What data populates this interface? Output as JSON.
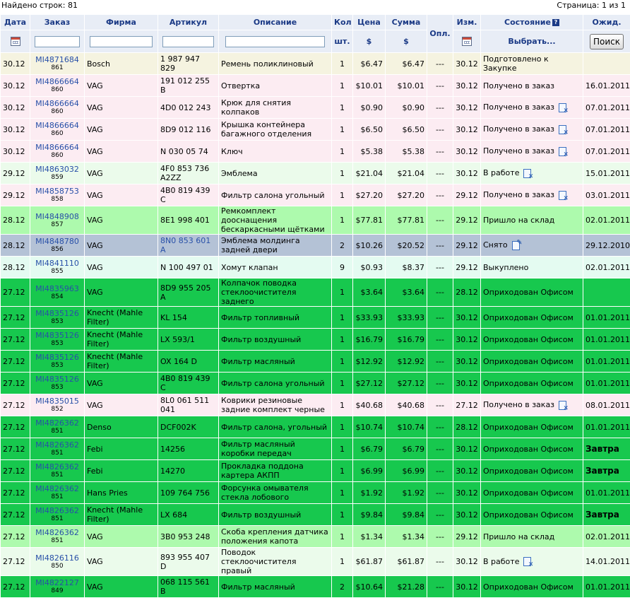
{
  "topbar": {
    "found_label": "Найдено строк: 81",
    "page_label": "Страница: 1 из 1"
  },
  "header": {
    "date": "Дата",
    "order": "Заказ",
    "firm": "Фирма",
    "article": "Артикул",
    "description": "Описание",
    "qty": "Кол",
    "qty_unit": "шт.",
    "price": "Цена",
    "price_unit": "$",
    "sum": "Сумма",
    "sum_unit": "$",
    "paid": "Опл.",
    "changed": "Изм.",
    "state": "Состояние",
    "state_select": "Выбрать...",
    "expected": "Ожид.",
    "search_button": "Поиск"
  },
  "colors": {
    "cream": "#f5f3e0",
    "pink": "#fcecf2",
    "lightgreen": "#ebfbeb",
    "green": "#adfaad",
    "blue": "#b4c2d6",
    "mint": "#e4fbf1",
    "bright": "#17c84e"
  },
  "rows": [
    {
      "date": "30.12",
      "order": "MI4871684",
      "sub": "861",
      "firm": "Bosch",
      "article": "1 987 947 829",
      "desc": "Ремень поликлиновый",
      "qty": "1",
      "price": "$6.47",
      "sum": "$6.47",
      "paid": "---",
      "changed": "30.12",
      "state": "Подготовлено к Закупке",
      "icon": "",
      "expected": "",
      "bg": "cream",
      "bold": false,
      "sku_link": false
    },
    {
      "date": "30.12",
      "order": "MI4866664",
      "sub": "860",
      "firm": "VAG",
      "article": "191 012 255 B",
      "desc": "Отвертка",
      "qty": "1",
      "price": "$10.01",
      "sum": "$10.01",
      "paid": "---",
      "changed": "30.12",
      "state": "Получено в заказ",
      "icon": "",
      "expected": "16.01.2011",
      "bg": "pink",
      "bold": false,
      "sku_link": false
    },
    {
      "date": "30.12",
      "order": "MI4866664",
      "sub": "860",
      "firm": "VAG",
      "article": "4D0 012 243",
      "desc": "Крюк для снятия колпаков",
      "qty": "1",
      "price": "$0.90",
      "sum": "$0.90",
      "paid": "---",
      "changed": "30.12",
      "state": "Получено в заказ",
      "icon": "delete",
      "expected": "07.01.2011",
      "bg": "pink",
      "bold": false,
      "sku_link": false
    },
    {
      "date": "30.12",
      "order": "MI4866664",
      "sub": "860",
      "firm": "VAG",
      "article": "8D9 012 116",
      "desc": "Крышка контейнера багажного отделения",
      "qty": "1",
      "price": "$6.50",
      "sum": "$6.50",
      "paid": "---",
      "changed": "30.12",
      "state": "Получено в заказ",
      "icon": "delete",
      "expected": "07.01.2011",
      "bg": "pink",
      "bold": false,
      "sku_link": false
    },
    {
      "date": "30.12",
      "order": "MI4866664",
      "sub": "860",
      "firm": "VAG",
      "article": "N 030 05 74",
      "desc": "Ключ",
      "qty": "1",
      "price": "$5.38",
      "sum": "$5.38",
      "paid": "---",
      "changed": "30.12",
      "state": "Получено в заказ",
      "icon": "delete",
      "expected": "07.01.2011",
      "bg": "pink",
      "bold": false,
      "sku_link": false
    },
    {
      "date": "29.12",
      "order": "MI4863032",
      "sub": "859",
      "firm": "VAG",
      "article": "4F0 853 736 A2ZZ",
      "desc": "Эмблема",
      "qty": "1",
      "price": "$21.04",
      "sum": "$21.04",
      "paid": "---",
      "changed": "30.12",
      "state": "В работе",
      "icon": "delete",
      "expected": "15.01.2011",
      "bg": "lightgreen",
      "bold": false,
      "sku_link": false
    },
    {
      "date": "29.12",
      "order": "MI4858753",
      "sub": "858",
      "firm": "VAG",
      "article": "4B0 819 439 C",
      "desc": "Фильтр салона угольный",
      "qty": "1",
      "price": "$27.20",
      "sum": "$27.20",
      "paid": "---",
      "changed": "29.12",
      "state": "Получено в заказ",
      "icon": "delete",
      "expected": "03.01.2011",
      "bg": "pink",
      "bold": false,
      "sku_link": false
    },
    {
      "date": "28.12",
      "order": "MI4848908",
      "sub": "857",
      "firm": "VAG",
      "article": "8E1 998 401",
      "desc": "Ремкомплект дооснащения бескаркасными щётками",
      "qty": "1",
      "price": "$77.81",
      "sum": "$77.81",
      "paid": "---",
      "changed": "29.12",
      "state": "Пришло на склад",
      "icon": "",
      "expected": "02.01.2011",
      "bg": "green",
      "bold": false,
      "sku_link": false
    },
    {
      "date": "28.12",
      "order": "MI4848780",
      "sub": "856",
      "firm": "VAG",
      "article": "8N0 853 601 A",
      "desc": "Эмблема молдинга задней двери",
      "qty": "2",
      "price": "$10.26",
      "sum": "$20.52",
      "paid": "---",
      "changed": "29.12",
      "state": "Снято",
      "icon": "edit",
      "expected": "29.12.2010",
      "bg": "blue",
      "bold": false,
      "sku_link": true
    },
    {
      "date": "28.12",
      "order": "MI4841110",
      "sub": "855",
      "firm": "VAG",
      "article": "N 100 497 01",
      "desc": "Хомут клапан",
      "qty": "9",
      "price": "$0.93",
      "sum": "$8.37",
      "paid": "---",
      "changed": "29.12",
      "state": "Выкуплено",
      "icon": "",
      "expected": "02.01.2011",
      "bg": "mint",
      "bold": false,
      "sku_link": false
    },
    {
      "date": "27.12",
      "order": "MI4835963",
      "sub": "854",
      "firm": "VAG",
      "article": "8D9 955 205 A",
      "desc": "Колпачок поводка стеклоочистителя заднего",
      "qty": "1",
      "price": "$3.64",
      "sum": "$3.64",
      "paid": "---",
      "changed": "28.12",
      "state": "Оприходован Офисом",
      "icon": "",
      "expected": "",
      "bg": "bright",
      "bold": false,
      "sku_link": false
    },
    {
      "date": "27.12",
      "order": "MI4835126",
      "sub": "853",
      "firm": "Knecht (Mahle Filter)",
      "article": "KL 154",
      "desc": "Фильтр топливный",
      "qty": "1",
      "price": "$33.93",
      "sum": "$33.93",
      "paid": "---",
      "changed": "30.12",
      "state": "Оприходован Офисом",
      "icon": "",
      "expected": "01.01.2011",
      "bg": "bright",
      "bold": false,
      "sku_link": false
    },
    {
      "date": "27.12",
      "order": "MI4835126",
      "sub": "853",
      "firm": "Knecht (Mahle Filter)",
      "article": "LX 593/1",
      "desc": "Фильтр воздушный",
      "qty": "1",
      "price": "$16.79",
      "sum": "$16.79",
      "paid": "---",
      "changed": "30.12",
      "state": "Оприходован Офисом",
      "icon": "",
      "expected": "01.01.2011",
      "bg": "bright",
      "bold": false,
      "sku_link": false
    },
    {
      "date": "27.12",
      "order": "MI4835126",
      "sub": "853",
      "firm": "Knecht (Mahle Filter)",
      "article": "OX 164 D",
      "desc": "Фильтр масляный",
      "qty": "1",
      "price": "$12.92",
      "sum": "$12.92",
      "paid": "---",
      "changed": "30.12",
      "state": "Оприходован Офисом",
      "icon": "",
      "expected": "01.01.2011",
      "bg": "bright",
      "bold": false,
      "sku_link": false
    },
    {
      "date": "27.12",
      "order": "MI4835126",
      "sub": "853",
      "firm": "VAG",
      "article": "4B0 819 439 C",
      "desc": "Фильтр салона угольный",
      "qty": "1",
      "price": "$27.12",
      "sum": "$27.12",
      "paid": "---",
      "changed": "30.12",
      "state": "Оприходован Офисом",
      "icon": "",
      "expected": "01.01.2011",
      "bg": "bright",
      "bold": false,
      "sku_link": false
    },
    {
      "date": "27.12",
      "order": "MI4835015",
      "sub": "852",
      "firm": "VAG",
      "article": "8L0 061 511 041",
      "desc": "Коврики резиновые задние комплект черные",
      "qty": "1",
      "price": "$40.68",
      "sum": "$40.68",
      "paid": "---",
      "changed": "27.12",
      "state": "Получено в заказ",
      "icon": "delete",
      "expected": "08.01.2011",
      "bg": "pink",
      "bold": false,
      "sku_link": false
    },
    {
      "date": "27.12",
      "order": "MI4826362",
      "sub": "851",
      "firm": "Denso",
      "article": "DCF002K",
      "desc": "Фильтр салона, угольный",
      "qty": "1",
      "price": "$10.74",
      "sum": "$10.74",
      "paid": "---",
      "changed": "28.12",
      "state": "Оприходован Офисом",
      "icon": "",
      "expected": "01.01.2011",
      "bg": "bright",
      "bold": false,
      "sku_link": false
    },
    {
      "date": "27.12",
      "order": "MI4826362",
      "sub": "851",
      "firm": "Febi",
      "article": "14256",
      "desc": "Фильтр масляный коробки передач",
      "qty": "1",
      "price": "$6.79",
      "sum": "$6.79",
      "paid": "---",
      "changed": "30.12",
      "state": "Оприходован Офисом",
      "icon": "",
      "expected": "Завтра",
      "bg": "bright",
      "bold": true,
      "sku_link": false
    },
    {
      "date": "27.12",
      "order": "MI4826362",
      "sub": "851",
      "firm": "Febi",
      "article": "14270",
      "desc": "Прокладка поддона картера АКПП",
      "qty": "1",
      "price": "$6.99",
      "sum": "$6.99",
      "paid": "---",
      "changed": "30.12",
      "state": "Оприходован Офисом",
      "icon": "",
      "expected": "Завтра",
      "bg": "bright",
      "bold": true,
      "sku_link": false
    },
    {
      "date": "27.12",
      "order": "MI4826362",
      "sub": "851",
      "firm": "Hans Pries",
      "article": "109 764 756",
      "desc": "Форсунка омывателя стекла лобового",
      "qty": "1",
      "price": "$1.92",
      "sum": "$1.92",
      "paid": "---",
      "changed": "30.12",
      "state": "Оприходован Офисом",
      "icon": "",
      "expected": "01.01.2011",
      "bg": "bright",
      "bold": false,
      "sku_link": false
    },
    {
      "date": "27.12",
      "order": "MI4826362",
      "sub": "851",
      "firm": "Knecht (Mahle Filter)",
      "article": "LX 684",
      "desc": "Фильтр воздушный",
      "qty": "1",
      "price": "$9.84",
      "sum": "$9.84",
      "paid": "---",
      "changed": "30.12",
      "state": "Оприходован Офисом",
      "icon": "",
      "expected": "Завтра",
      "bg": "bright",
      "bold": true,
      "sku_link": false
    },
    {
      "date": "27.12",
      "order": "MI4826362",
      "sub": "851",
      "firm": "VAG",
      "article": "3B0 953 248",
      "desc": "Скоба крепления датчика положения капота",
      "qty": "1",
      "price": "$1.34",
      "sum": "$1.34",
      "paid": "---",
      "changed": "29.12",
      "state": "Пришло на склад",
      "icon": "",
      "expected": "02.01.2011",
      "bg": "green",
      "bold": false,
      "sku_link": false
    },
    {
      "date": "27.12",
      "order": "MI4826116",
      "sub": "850",
      "firm": "VAG",
      "article": "893 955 407 D",
      "desc": "Поводок стеклоочистителя правый",
      "qty": "1",
      "price": "$61.87",
      "sum": "$61.87",
      "paid": "---",
      "changed": "30.12",
      "state": "В работе",
      "icon": "delete",
      "expected": "14.01.2011",
      "bg": "lightgreen",
      "bold": false,
      "sku_link": false
    },
    {
      "date": "27.12",
      "order": "MI4822127",
      "sub": "849",
      "firm": "VAG",
      "article": "068 115 561 B",
      "desc": "Фильтр масляный",
      "qty": "2",
      "price": "$10.64",
      "sum": "$21.28",
      "paid": "---",
      "changed": "30.12",
      "state": "Оприходован Офисом",
      "icon": "",
      "expected": "01.01.2011",
      "bg": "bright",
      "bold": false,
      "sku_link": false
    }
  ]
}
